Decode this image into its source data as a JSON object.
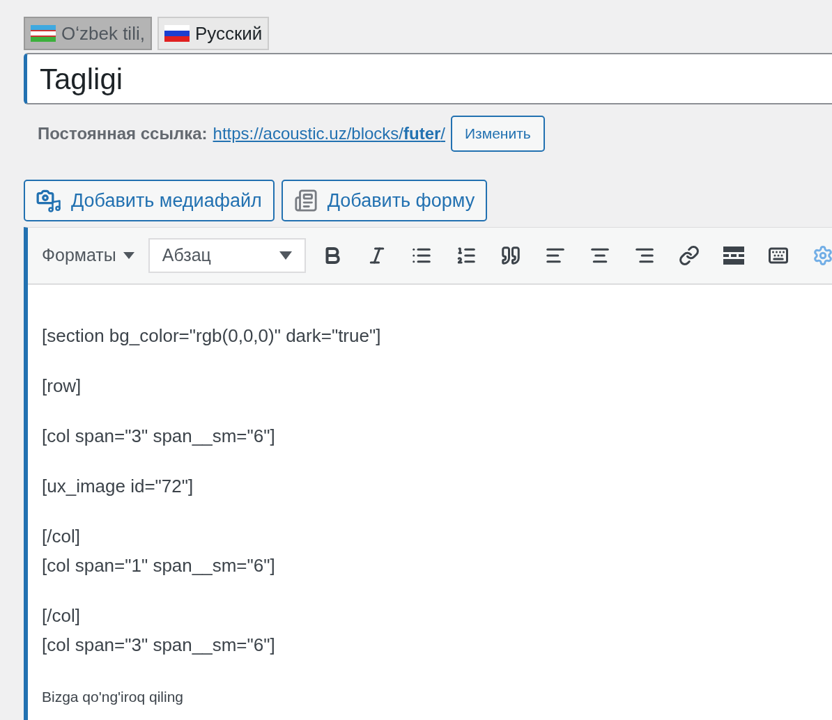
{
  "language_tabs": [
    {
      "label": "Oʻzbek tili,",
      "selected": true
    },
    {
      "label": "Русский",
      "selected": false
    }
  ],
  "title_field": {
    "value": "Tagligi"
  },
  "permalink": {
    "label": "Постоянная ссылка:",
    "url_prefix": "https://acoustic.uz/blocks/",
    "slug": "futer",
    "url_suffix": "/",
    "edit_button": "Изменить"
  },
  "media_buttons": [
    {
      "label": "Добавить медиафайл"
    },
    {
      "label": "Добавить форму"
    }
  ],
  "toolbar": {
    "formats": "Форматы",
    "block_select": "Абзац"
  },
  "content": [
    {
      "kind": "normal",
      "lines": [
        "[section bg_color=\"rgb(0,0,0)\" dark=\"true\"]"
      ]
    },
    {
      "kind": "normal",
      "lines": [
        "[row]"
      ]
    },
    {
      "kind": "normal",
      "lines": [
        "[col span=\"3\" span__sm=\"6\"]"
      ]
    },
    {
      "kind": "normal",
      "lines": [
        "[ux_image id=\"72\"]"
      ]
    },
    {
      "kind": "normal",
      "lines": [
        "[/col]",
        "[col span=\"1\" span__sm=\"6\"]"
      ]
    },
    {
      "kind": "normal",
      "lines": [
        "[/col]",
        "[col span=\"3\" span__sm=\"6\"]"
      ]
    },
    {
      "kind": "small",
      "lines": [
        "Bizga qo'ng'iroq qiling"
      ]
    }
  ]
}
